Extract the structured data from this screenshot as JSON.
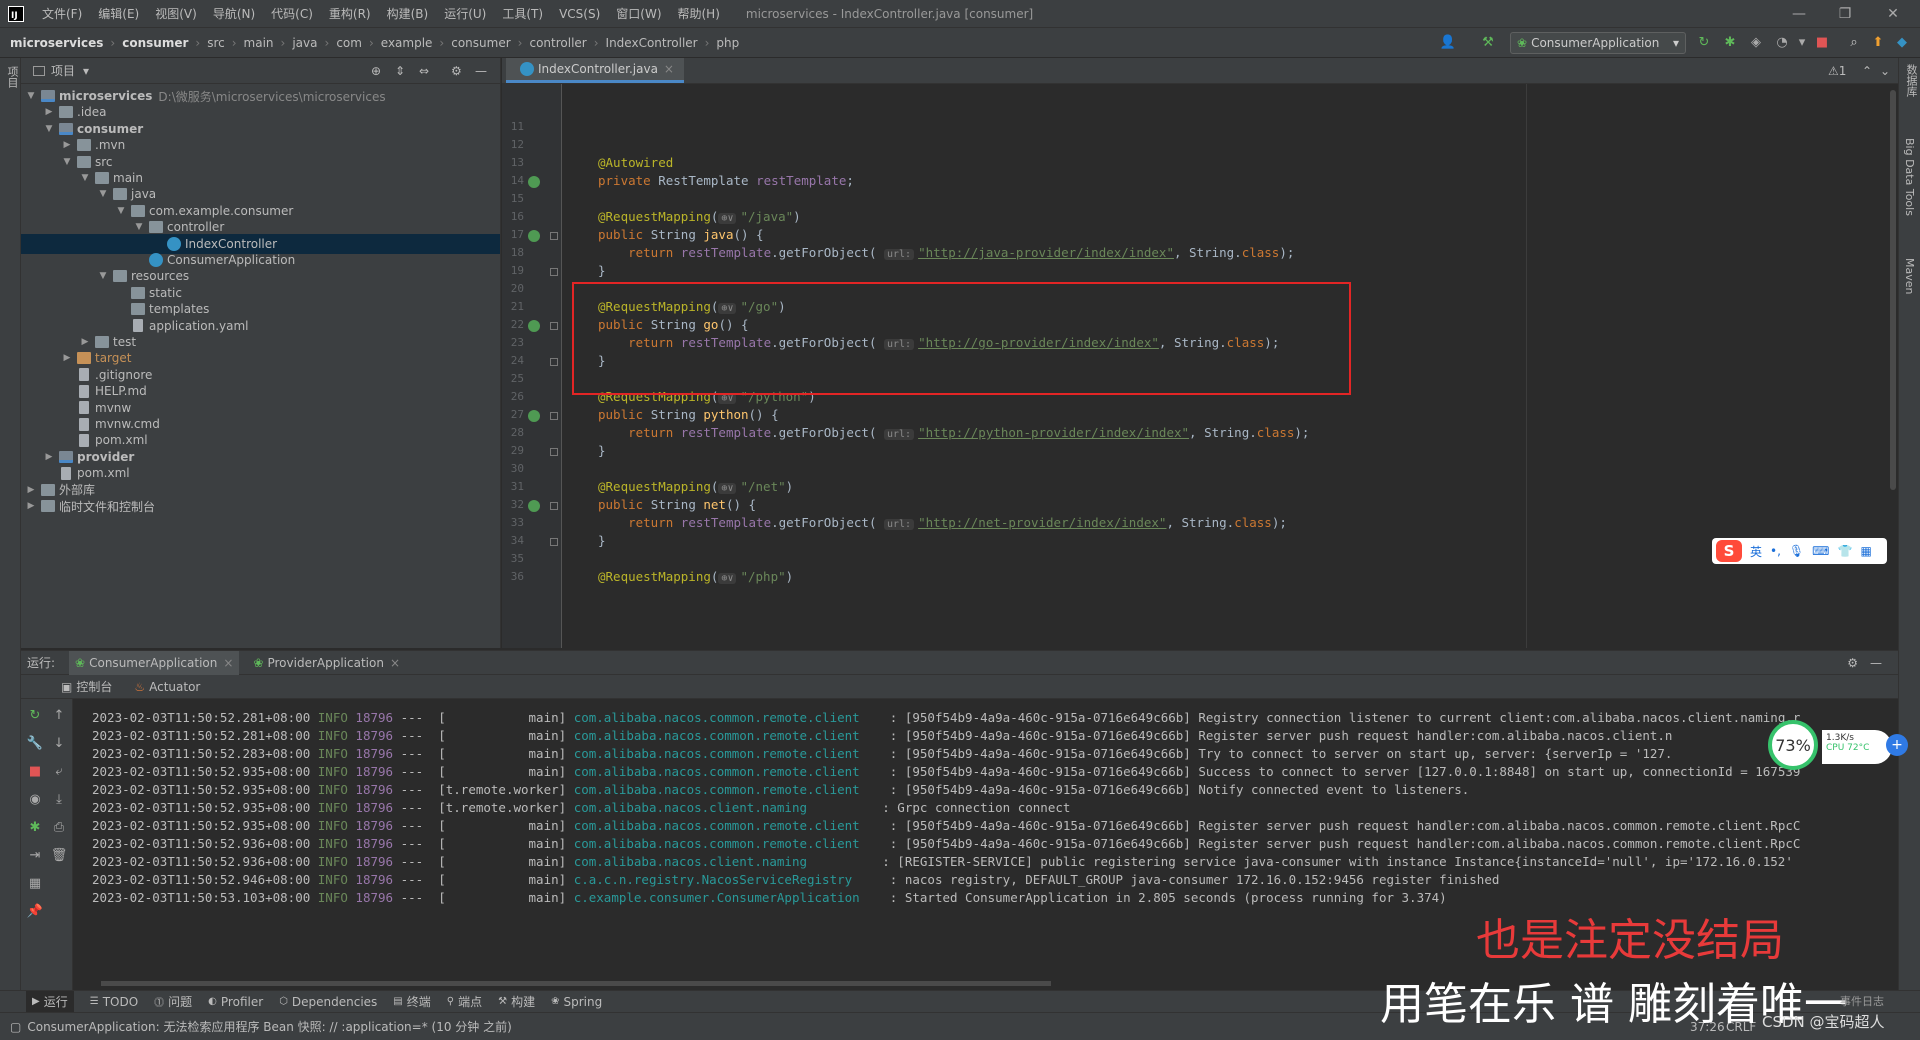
{
  "menubar": {
    "items": [
      "文件(F)",
      "编辑(E)",
      "视图(V)",
      "导航(N)",
      "代码(C)",
      "重构(R)",
      "构建(B)",
      "运行(U)",
      "工具(T)",
      "VCS(S)",
      "窗口(W)",
      "帮助(H)"
    ],
    "window_title": "microservices - IndexController.java [consumer]"
  },
  "breadcrumbs": [
    "microservices",
    "consumer",
    "src",
    "main",
    "java",
    "com",
    "example",
    "consumer",
    "controller",
    "IndexController",
    "php"
  ],
  "run_config": "ConsumerApplication",
  "left_strip_label": "项目",
  "right_strip_labels": [
    "数据库",
    "Big Data Tools",
    "Maven"
  ],
  "project": {
    "header": "项目",
    "tree": [
      {
        "label": "microservices",
        "path": "D:\\微服务\\microservices\\microservices",
        "depth": 0,
        "arrow": "▼",
        "icon": "folder-mod",
        "bold": true
      },
      {
        "label": ".idea",
        "depth": 1,
        "arrow": "▶",
        "icon": "folder"
      },
      {
        "label": "consumer",
        "depth": 1,
        "arrow": "▼",
        "icon": "folder-mod",
        "bold": true
      },
      {
        "label": ".mvn",
        "depth": 2,
        "arrow": "▶",
        "icon": "folder"
      },
      {
        "label": "src",
        "depth": 2,
        "arrow": "▼",
        "icon": "folder"
      },
      {
        "label": "main",
        "depth": 3,
        "arrow": "▼",
        "icon": "folder"
      },
      {
        "label": "java",
        "depth": 4,
        "arrow": "▼",
        "icon": "folder"
      },
      {
        "label": "com.example.consumer",
        "depth": 5,
        "arrow": "▼",
        "icon": "folder"
      },
      {
        "label": "controller",
        "depth": 6,
        "arrow": "▼",
        "icon": "folder"
      },
      {
        "label": "IndexController",
        "depth": 7,
        "arrow": "",
        "icon": "class",
        "selected": true
      },
      {
        "label": "ConsumerApplication",
        "depth": 6,
        "arrow": "",
        "icon": "class"
      },
      {
        "label": "resources",
        "depth": 4,
        "arrow": "▼",
        "icon": "folder"
      },
      {
        "label": "static",
        "depth": 5,
        "arrow": "",
        "icon": "folder"
      },
      {
        "label": "templates",
        "depth": 5,
        "arrow": "",
        "icon": "folder"
      },
      {
        "label": "application.yaml",
        "depth": 5,
        "arrow": "",
        "icon": "file"
      },
      {
        "label": "test",
        "depth": 3,
        "arrow": "▶",
        "icon": "folder"
      },
      {
        "label": "target",
        "depth": 2,
        "arrow": "▶",
        "icon": "folder-orange"
      },
      {
        "label": ".gitignore",
        "depth": 2,
        "arrow": "",
        "icon": "file"
      },
      {
        "label": "HELP.md",
        "depth": 2,
        "arrow": "",
        "icon": "file"
      },
      {
        "label": "mvnw",
        "depth": 2,
        "arrow": "",
        "icon": "file"
      },
      {
        "label": "mvnw.cmd",
        "depth": 2,
        "arrow": "",
        "icon": "file"
      },
      {
        "label": "pom.xml",
        "depth": 2,
        "arrow": "",
        "icon": "file"
      },
      {
        "label": "provider",
        "depth": 1,
        "arrow": "▶",
        "icon": "folder-mod",
        "bold": true
      },
      {
        "label": "pom.xml",
        "depth": 1,
        "arrow": "",
        "icon": "file"
      },
      {
        "label": "外部库",
        "depth": 0,
        "arrow": "▶",
        "icon": "folder"
      },
      {
        "label": "临时文件和控制台",
        "depth": 0,
        "arrow": "▶",
        "icon": "folder"
      }
    ]
  },
  "editor": {
    "tab": "IndexController.java",
    "inspection": "⚠1",
    "lines": [
      {
        "n": "11",
        "html": ""
      },
      {
        "n": "12",
        "html": ""
      },
      {
        "n": "13",
        "html": "<span class=\"ann\">@Autowired</span>"
      },
      {
        "n": "14",
        "html": "<span class=\"kw\">private </span>RestTemplate <span class=\"fld\">restTemplate</span>;",
        "gicon": true
      },
      {
        "n": "15",
        "html": ""
      },
      {
        "n": "16",
        "html": "<span class=\"ann\">@RequestMapping</span>(<span class=\"hint\">⊕∨</span><span class=\"str\">\"/java\"</span>)"
      },
      {
        "n": "17",
        "html": "<span class=\"kw\">public </span>String <span class=\"fn\">java</span>() {",
        "gicon": true,
        "fold": true
      },
      {
        "n": "18",
        "html": "    <span class=\"kw\">return </span><span class=\"fld\">restTemplate</span>.getForObject( <span class=\"hint\">url:</span><span class=\"url\">\"http://java-provider/index/index\"</span>, String.<span class=\"kw\">class</span>);"
      },
      {
        "n": "19",
        "html": "}",
        "fold": true
      },
      {
        "n": "20",
        "html": ""
      },
      {
        "n": "21",
        "html": "<span class=\"ann\">@RequestMapping</span>(<span class=\"hint\">⊕∨</span><span class=\"str\">\"/go\"</span>)"
      },
      {
        "n": "22",
        "html": "<span class=\"kw\">public </span>String <span class=\"fn\">go</span>() {",
        "gicon": true,
        "fold": true
      },
      {
        "n": "23",
        "html": "    <span class=\"kw\">return </span><span class=\"fld\">restTemplate</span>.getForObject( <span class=\"hint\">url:</span><span class=\"url\">\"http://go-provider/index/index\"</span>, String.<span class=\"kw\">class</span>);"
      },
      {
        "n": "24",
        "html": "}",
        "fold": true
      },
      {
        "n": "25",
        "html": ""
      },
      {
        "n": "26",
        "html": "<span class=\"ann\">@RequestMapping</span>(<span class=\"hint\">⊕∨</span><span class=\"str\">\"/python\"</span>)"
      },
      {
        "n": "27",
        "html": "<span class=\"kw\">public </span>String <span class=\"fn\">python</span>() {",
        "gicon": true,
        "fold": true
      },
      {
        "n": "28",
        "html": "    <span class=\"kw\">return </span><span class=\"fld\">restTemplate</span>.getForObject( <span class=\"hint\">url:</span><span class=\"url\">\"http://python-provider/index/index\"</span>, String.<span class=\"kw\">class</span>);"
      },
      {
        "n": "29",
        "html": "}",
        "fold": true
      },
      {
        "n": "30",
        "html": ""
      },
      {
        "n": "31",
        "html": "<span class=\"ann\">@RequestMapping</span>(<span class=\"hint\">⊕∨</span><span class=\"str\">\"/net\"</span>)"
      },
      {
        "n": "32",
        "html": "<span class=\"kw\">public </span>String <span class=\"fn\">net</span>() {",
        "gicon": true,
        "fold": true
      },
      {
        "n": "33",
        "html": "    <span class=\"kw\">return </span><span class=\"fld\">restTemplate</span>.getForObject( <span class=\"hint\">url:</span><span class=\"url\">\"http://net-provider/index/index\"</span>, String.<span class=\"kw\">class</span>);"
      },
      {
        "n": "34",
        "html": "}",
        "fold": true
      },
      {
        "n": "35",
        "html": ""
      },
      {
        "n": "36",
        "html": "<span class=\"ann\">@RequestMapping</span>(<span class=\"hint\">⊕∨</span><span class=\"str\">\"/php\"</span>)"
      }
    ]
  },
  "run": {
    "label": "运行:",
    "tabs": [
      "ConsumerApplication",
      "ProviderApplication"
    ],
    "subtabs": [
      "控制台",
      "Actuator"
    ],
    "logs": [
      {
        "ts": "2023-02-03T11:50:52.281+08:00",
        "lvl": "INFO",
        "pid": "18796",
        "thread": "---  [           main]",
        "logger": "com.alibaba.nacos.common.remote.client  ",
        "msg": " : [950f54b9-4a9a-460c-915a-0716e649c66b] Registry connection listener to current client:com.alibaba.nacos.client.naming.r"
      },
      {
        "ts": "2023-02-03T11:50:52.281+08:00",
        "lvl": "INFO",
        "pid": "18796",
        "thread": "---  [           main]",
        "logger": "com.alibaba.nacos.common.remote.client  ",
        "msg": " : [950f54b9-4a9a-460c-915a-0716e649c66b] Register server push request handler:com.alibaba.nacos.client.n"
      },
      {
        "ts": "2023-02-03T11:50:52.283+08:00",
        "lvl": "INFO",
        "pid": "18796",
        "thread": "---  [           main]",
        "logger": "com.alibaba.nacos.common.remote.client  ",
        "msg": " : [950f54b9-4a9a-460c-915a-0716e649c66b] Try to connect to server on start up, server: {serverIp = '127."
      },
      {
        "ts": "2023-02-03T11:50:52.935+08:00",
        "lvl": "INFO",
        "pid": "18796",
        "thread": "---  [           main]",
        "logger": "com.alibaba.nacos.common.remote.client  ",
        "msg": " : [950f54b9-4a9a-460c-915a-0716e649c66b] Success to connect to server [127.0.0.1:8848] on start up, connectionId = 167539"
      },
      {
        "ts": "2023-02-03T11:50:52.935+08:00",
        "lvl": "INFO",
        "pid": "18796",
        "thread": "---  [t.remote.worker]",
        "logger": "com.alibaba.nacos.common.remote.client  ",
        "msg": " : [950f54b9-4a9a-460c-915a-0716e649c66b] Notify connected event to listeners."
      },
      {
        "ts": "2023-02-03T11:50:52.935+08:00",
        "lvl": "INFO",
        "pid": "18796",
        "thread": "---  [t.remote.worker]",
        "logger": "com.alibaba.nacos.client.naming        ",
        "msg": " : Grpc connection connect"
      },
      {
        "ts": "2023-02-03T11:50:52.935+08:00",
        "lvl": "INFO",
        "pid": "18796",
        "thread": "---  [           main]",
        "logger": "com.alibaba.nacos.common.remote.client  ",
        "msg": " : [950f54b9-4a9a-460c-915a-0716e649c66b] Register server push request handler:com.alibaba.nacos.common.remote.client.RpcC"
      },
      {
        "ts": "2023-02-03T11:50:52.936+08:00",
        "lvl": "INFO",
        "pid": "18796",
        "thread": "---  [           main]",
        "logger": "com.alibaba.nacos.common.remote.client  ",
        "msg": " : [950f54b9-4a9a-460c-915a-0716e649c66b] Register server push request handler:com.alibaba.nacos.common.remote.client.RpcC"
      },
      {
        "ts": "2023-02-03T11:50:52.936+08:00",
        "lvl": "INFO",
        "pid": "18796",
        "thread": "---  [           main]",
        "logger": "com.alibaba.nacos.client.naming        ",
        "msg": " : [REGISTER-SERVICE] public registering service java-consumer with instance Instance{instanceId='null', ip='172.16.0.152'"
      },
      {
        "ts": "2023-02-03T11:50:52.946+08:00",
        "lvl": "INFO",
        "pid": "18796",
        "thread": "---  [           main]",
        "logger": "c.a.c.n.registry.NacosServiceRegistry   ",
        "msg": " : nacos registry, DEFAULT_GROUP java-consumer 172.16.0.152:9456 register finished"
      },
      {
        "ts": "2023-02-03T11:50:53.103+08:00",
        "lvl": "INFO",
        "pid": "18796",
        "thread": "---  [           main]",
        "logger": "c.example.consumer.ConsumerApplication  ",
        "msg": " : Started ConsumerApplication in 2.805 seconds (process running for 3.374)"
      }
    ]
  },
  "bottom_tools": [
    "运行",
    "TODO",
    "问题",
    "Profiler",
    "Dependencies",
    "终端",
    "端点",
    "构建",
    "Spring"
  ],
  "event_log": "事件日志",
  "status": {
    "message": "ConsumerApplication: 无法检索应用程序 Bean 快照: // :application=* (10 分钟 之前)",
    "position": "37:26",
    "line_sep": "CRLF"
  },
  "overlays": {
    "lyric1": "也是注定没结局",
    "lyric2": "用笔在乐 谱 雕刻着唯一",
    "watermark": "CSDN @宝码超人"
  },
  "perf": {
    "percent": "73%",
    "net": "1.3K/s",
    "cpu": "CPU 72°C"
  },
  "ime": {
    "label": "英"
  }
}
